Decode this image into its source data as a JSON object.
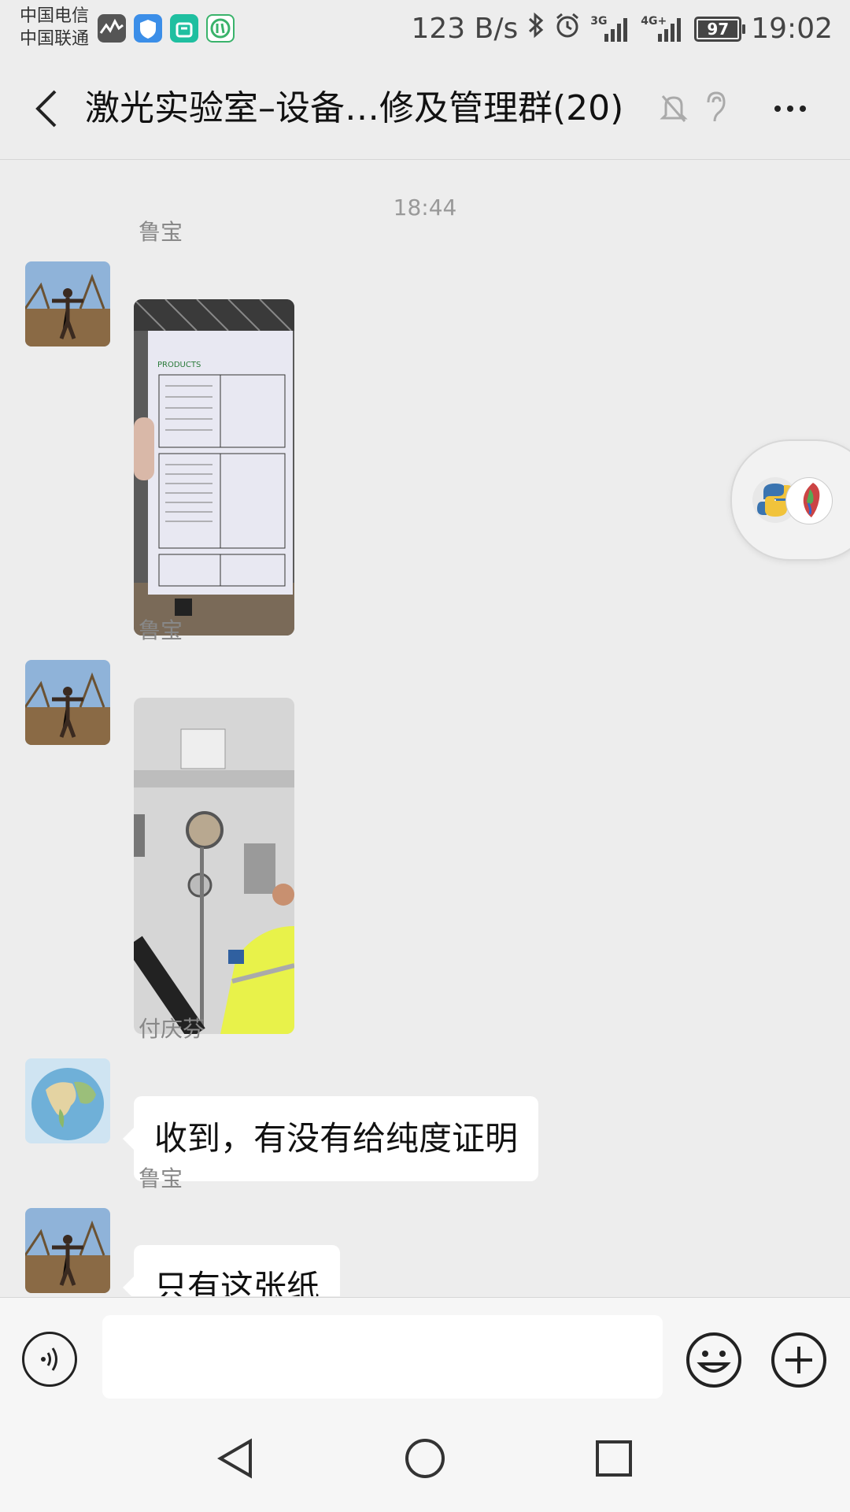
{
  "status_bar": {
    "carrier1": "中国电信",
    "carrier2": "中国联通",
    "net_speed": "123 B/s",
    "net_3g": "3G",
    "net_4g": "4G+",
    "battery": "97",
    "time": "19:02"
  },
  "header": {
    "title": "激光实验室–设备…修及管理群(20)"
  },
  "chat": {
    "timestamp": "18:44",
    "messages": [
      {
        "sender": "鲁宝",
        "type": "image",
        "image": "document-photo"
      },
      {
        "sender": "鲁宝",
        "type": "image",
        "image": "gas-tank-photo"
      },
      {
        "sender": "付庆芬",
        "type": "text",
        "text": "收到，有没有给纯度证明"
      },
      {
        "sender": "鲁宝",
        "type": "text",
        "text": "只有这张纸"
      }
    ]
  },
  "input": {
    "value": "",
    "placeholder": ""
  },
  "colors": {
    "background": "#ededed",
    "bubble": "#ffffff",
    "sender": "#888888"
  },
  "icons": [
    "back-icon",
    "mute-bell-icon",
    "ear-icon",
    "more-icon",
    "voice-icon",
    "emoji-icon",
    "plus-icon",
    "nav-back-icon",
    "nav-home-icon",
    "nav-recent-icon"
  ]
}
